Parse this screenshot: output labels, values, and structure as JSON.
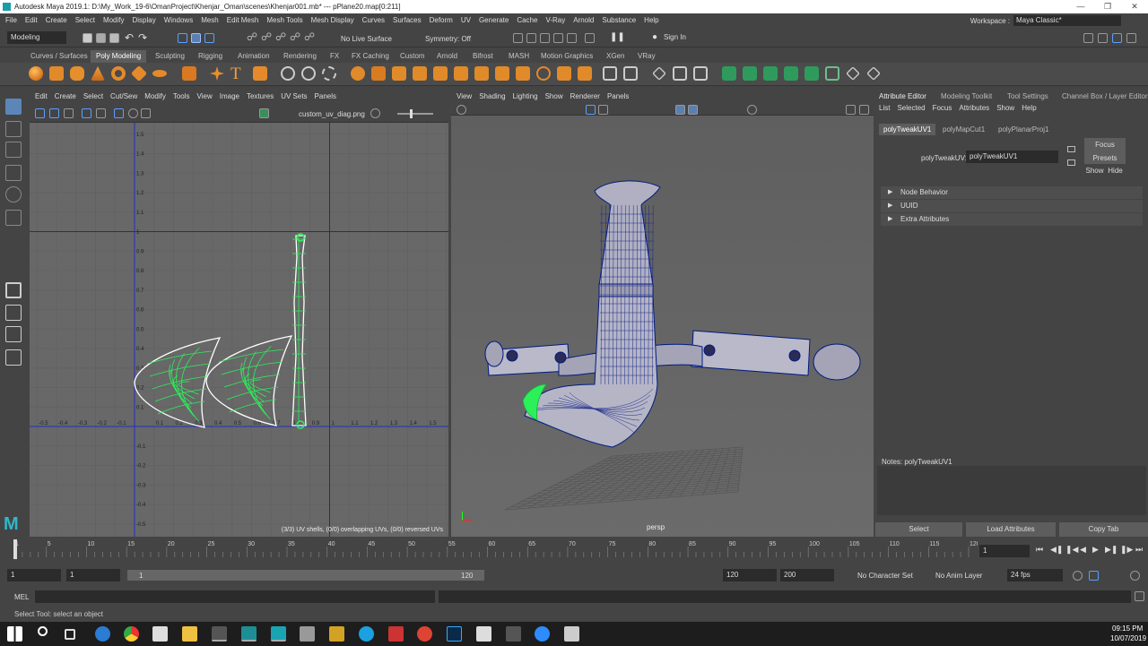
{
  "title": {
    "text": "Autodesk Maya 2019.1: D:\\My_Work_19-6\\OmanProject\\Khenjar_Oman\\scenes\\Khenjar001.mb*   ---   pPlane20.map[0:211]"
  },
  "menu": [
    "File",
    "Edit",
    "Create",
    "Select",
    "Modify",
    "Display",
    "Windows",
    "Mesh",
    "Edit Mesh",
    "Mesh Tools",
    "Mesh Display",
    "Curves",
    "Surfaces",
    "Deform",
    "UV",
    "Generate",
    "Cache",
    "V-Ray",
    "Arnold",
    "Substance",
    "Help"
  ],
  "workspace": {
    "label": "Workspace :",
    "value": "Maya Classic*"
  },
  "status": {
    "mode": "Modeling",
    "live_surface": "No Live Surface",
    "symmetry": "Symmetry: Off",
    "sign_in": "Sign In"
  },
  "shelf_tabs": [
    "Curves / Surfaces",
    "Poly Modeling",
    "Sculpting",
    "Rigging",
    "Animation",
    "Rendering",
    "FX",
    "FX Caching",
    "Custom",
    "Arnold",
    "Bifrost",
    "MASH",
    "Motion Graphics",
    "XGen",
    "VRay"
  ],
  "shelf_active": "Poly Modeling",
  "uv": {
    "menu": [
      "Edit",
      "Create",
      "Select",
      "Cut/Sew",
      "Modify",
      "Tools",
      "View",
      "Image",
      "Textures",
      "UV Sets",
      "Panels"
    ],
    "texture": "custom_uv_diag.png",
    "x_ticks_neg": [
      "-0.5",
      "-0.4",
      "-0.3",
      "-0.2",
      "-0.1"
    ],
    "x_ticks_pos": [
      "0.1",
      "0.2",
      "0.3",
      "0.4",
      "0.5",
      "0.6",
      "0.7",
      "0.8",
      "0.9",
      "1",
      "1.1",
      "1.2",
      "1.3",
      "1.4",
      "1.5"
    ],
    "y_ticks_pos": [
      "1.5",
      "1.4",
      "1.3",
      "1.2",
      "1.1",
      "1",
      "0.9",
      "0.8",
      "0.7",
      "0.6",
      "0.5",
      "0.4",
      "0.3",
      "0.2",
      "0.1"
    ],
    "y_ticks_neg": [
      "-0.1",
      "-0.2",
      "-0.3",
      "-0.4",
      "-0.5"
    ],
    "stats": "(3/3) UV shells, (0/0) overlapping UVs, (0/0) reversed UVs"
  },
  "viewport": {
    "menu": [
      "View",
      "Shading",
      "Lighting",
      "Show",
      "Renderer",
      "Panels"
    ],
    "camera": "persp"
  },
  "ae": {
    "tabs": [
      "Attribute Editor",
      "Modeling Toolkit",
      "Tool Settings",
      "Channel Box / Layer Editor"
    ],
    "menu": [
      "List",
      "Selected",
      "Focus",
      "Attributes",
      "Show",
      "Help"
    ],
    "node_tabs": [
      "polyTweakUV1",
      "polyMapCut1",
      "polyPlanarProj1"
    ],
    "field_label": "polyTweakUV:",
    "field_value": "polyTweakUV1",
    "focus": "Focus",
    "presets": "Presets",
    "show": "Show",
    "hide": "Hide",
    "sections": [
      "Node Behavior",
      "UUID",
      "Extra Attributes"
    ],
    "notes": "Notes: polyTweakUV1",
    "buttons": [
      "Select",
      "Load Attributes",
      "Copy Tab"
    ]
  },
  "timeline": {
    "ticks": [
      "1",
      "5",
      "10",
      "15",
      "20",
      "25",
      "30",
      "35",
      "40",
      "45",
      "50",
      "55",
      "60",
      "65",
      "70",
      "75",
      "80",
      "85",
      "90",
      "95",
      "100",
      "105",
      "110",
      "115",
      "120"
    ],
    "current": "1"
  },
  "range": {
    "start": "1",
    "anim_start": "1",
    "slider_start": "1",
    "slider_end": "120",
    "end": "120",
    "anim_end": "200",
    "character": "No Character Set",
    "anim_layer": "No Anim Layer",
    "fps": "24 fps"
  },
  "mel": {
    "label": "MEL"
  },
  "help": "Select Tool: select an object",
  "clock": {
    "time": "09:15 PM",
    "date": "10/07/2019"
  }
}
